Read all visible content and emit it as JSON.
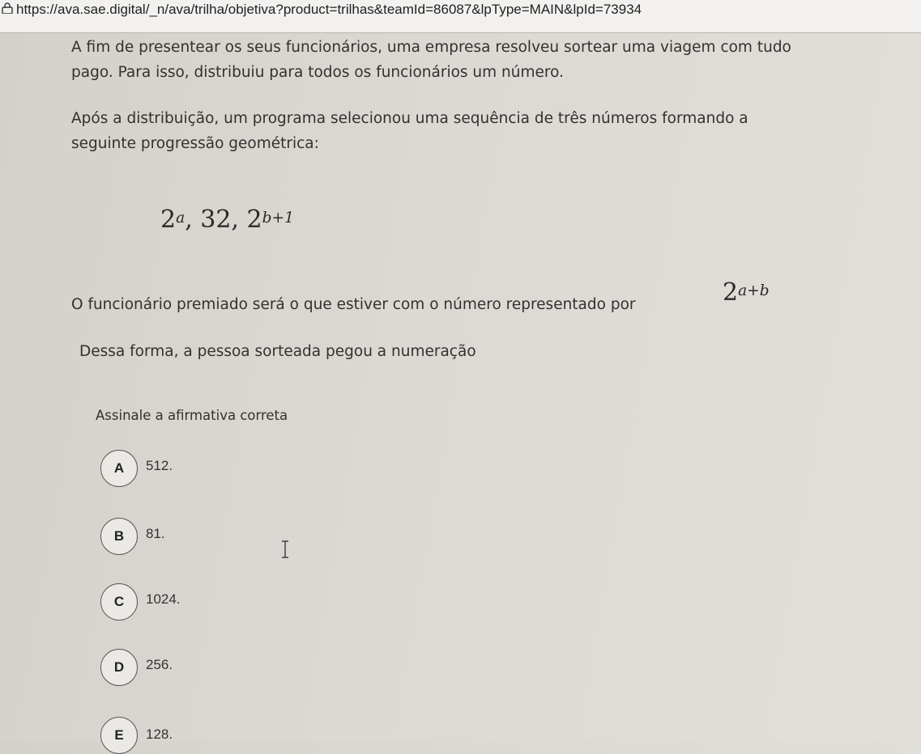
{
  "browser": {
    "url": "https://ava.sae.digital/_n/ava/trilha/objetiva?product=trilhas&teamId=86087&lpType=MAIN&lpId=73934",
    "lock_icon": "lock-icon"
  },
  "question": {
    "paragraph1_line1": "A fim  de presentear os seus funcionários, uma empresa resolveu sortear uma viagem com tudo",
    "paragraph1_line2": "pago. Para isso, distribuiu para todos os funcionários um número.",
    "paragraph2_line1": "Após a distribuição, um programa selecionou uma sequência de três números formando a",
    "paragraph2_line2": "seguinte progressão geométrica:",
    "sequence": {
      "base1": "2",
      "exp1": "a",
      "sep1": ", 32, ",
      "base3": "2",
      "exp3": "b+1"
    },
    "paragraph3": "O funcionário premiado será o que estiver com o número representado por",
    "formula": {
      "base": "2",
      "exp": "a+b"
    },
    "paragraph4": "Dessa forma, a pessoa sorteada pegou a numeração",
    "instruction": "Assinale a afirmativa correta"
  },
  "options": [
    {
      "letter": "A",
      "value": "512."
    },
    {
      "letter": "B",
      "value": "81."
    },
    {
      "letter": "C",
      "value": "1024."
    },
    {
      "letter": "D",
      "value": "256."
    },
    {
      "letter": "E",
      "value": "128."
    }
  ]
}
